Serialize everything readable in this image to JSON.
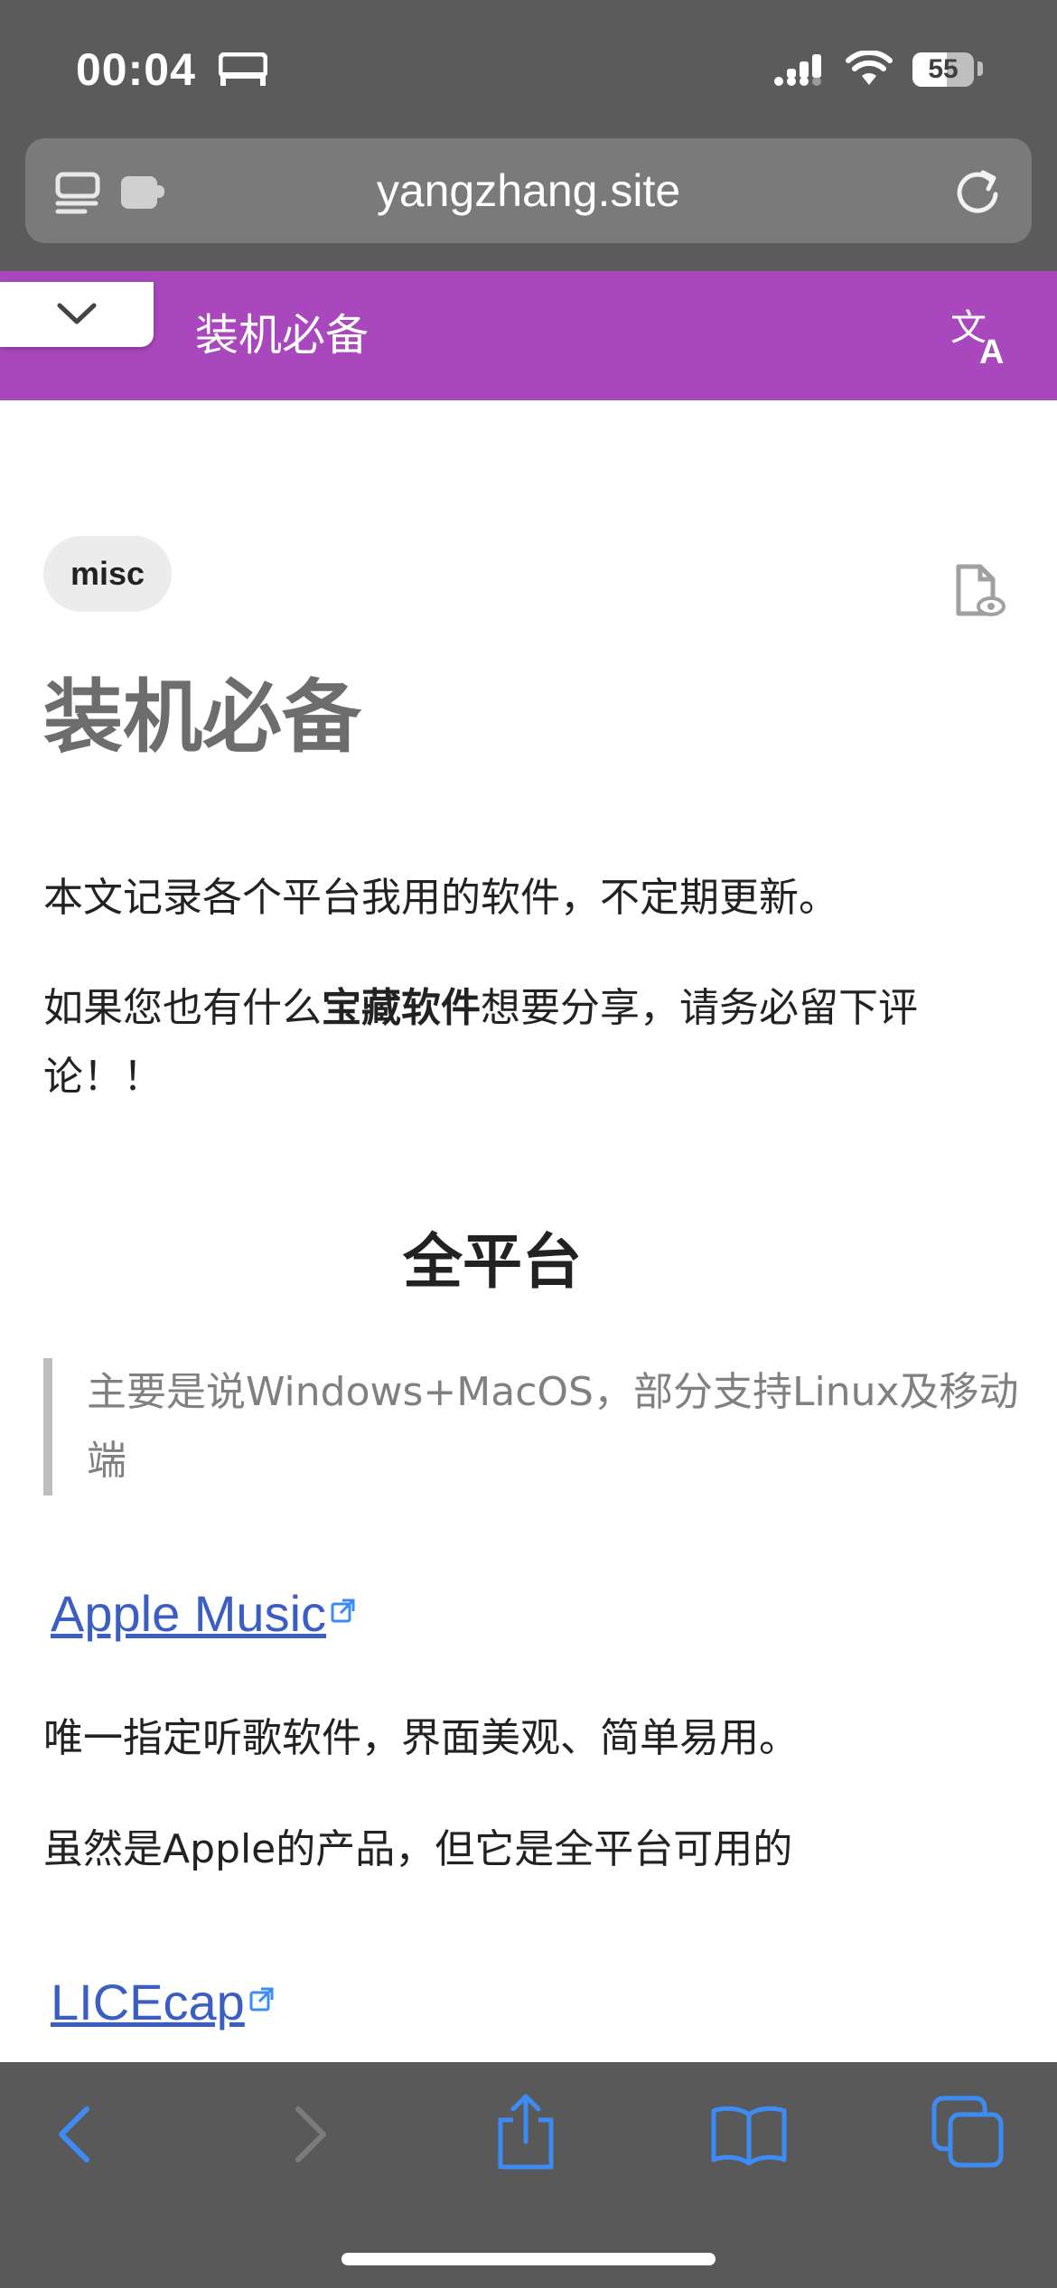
{
  "status_bar": {
    "time": "00:04",
    "battery": "55",
    "icons": [
      "bed-icon",
      "signal-icon",
      "wifi-icon",
      "battery-icon"
    ]
  },
  "browser": {
    "url": "yangzhang.site",
    "icons": [
      "tab-overview-icon",
      "extension-icon",
      "reload-icon"
    ]
  },
  "site_header": {
    "title": "装机必备",
    "background": "#a947bd",
    "icons": [
      "chevron-down-icon",
      "translate-icon"
    ]
  },
  "article": {
    "tag": "misc",
    "title": "装机必备",
    "intro": "本文记录各个平台我用的软件，不定期更新。",
    "cta_before": "如果您也有什么",
    "cta_bold": "宝藏软件",
    "cta_after": "想要分享，请务必留下评论！！",
    "section_heading": "全平台",
    "section_quote": "主要是说Windows+MacOS，部分支持Linux及移动端",
    "items": [
      {
        "name": "Apple Music",
        "lines": [
          "唯一指定听歌软件，界面美观、简单易用。",
          "虽然是Apple的产品，但它是全平台可用的"
        ]
      },
      {
        "name": "LICEcap",
        "lines": []
      }
    ],
    "link_color": "#3b5ec4"
  },
  "toolbar": {
    "buttons": [
      "back-button",
      "forward-button",
      "share-button",
      "bookmarks-button",
      "tabs-button"
    ],
    "accent": "#3d8bf5"
  }
}
